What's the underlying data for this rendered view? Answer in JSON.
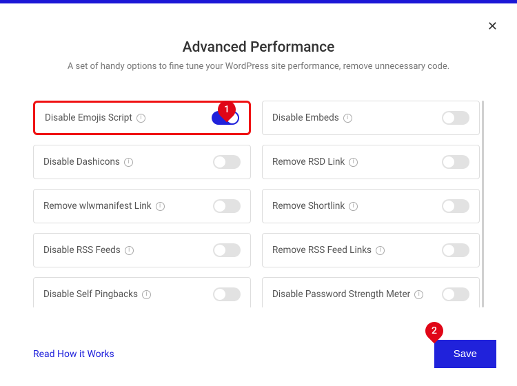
{
  "header": {
    "title": "Advanced Performance",
    "subtitle": "A set of handy options to fine tune your WordPress site performance, remove unnecessary code."
  },
  "options": {
    "left": [
      {
        "label": "Disable Emojis Script",
        "on": true,
        "highlighted": true
      },
      {
        "label": "Disable Dashicons",
        "on": false
      },
      {
        "label": "Remove wlwmanifest Link",
        "on": false
      },
      {
        "label": "Disable RSS Feeds",
        "on": false
      },
      {
        "label": "Disable Self Pingbacks",
        "on": false
      }
    ],
    "right": [
      {
        "label": "Disable Embeds",
        "on": false
      },
      {
        "label": "Remove RSD Link",
        "on": false
      },
      {
        "label": "Remove Shortlink",
        "on": false
      },
      {
        "label": "Remove RSS Feed Links",
        "on": false
      },
      {
        "label": "Disable Password Strength Meter",
        "on": false
      }
    ]
  },
  "markers": {
    "m1": "1",
    "m2": "2"
  },
  "footer": {
    "link": "Read How it Works",
    "save": "Save"
  }
}
